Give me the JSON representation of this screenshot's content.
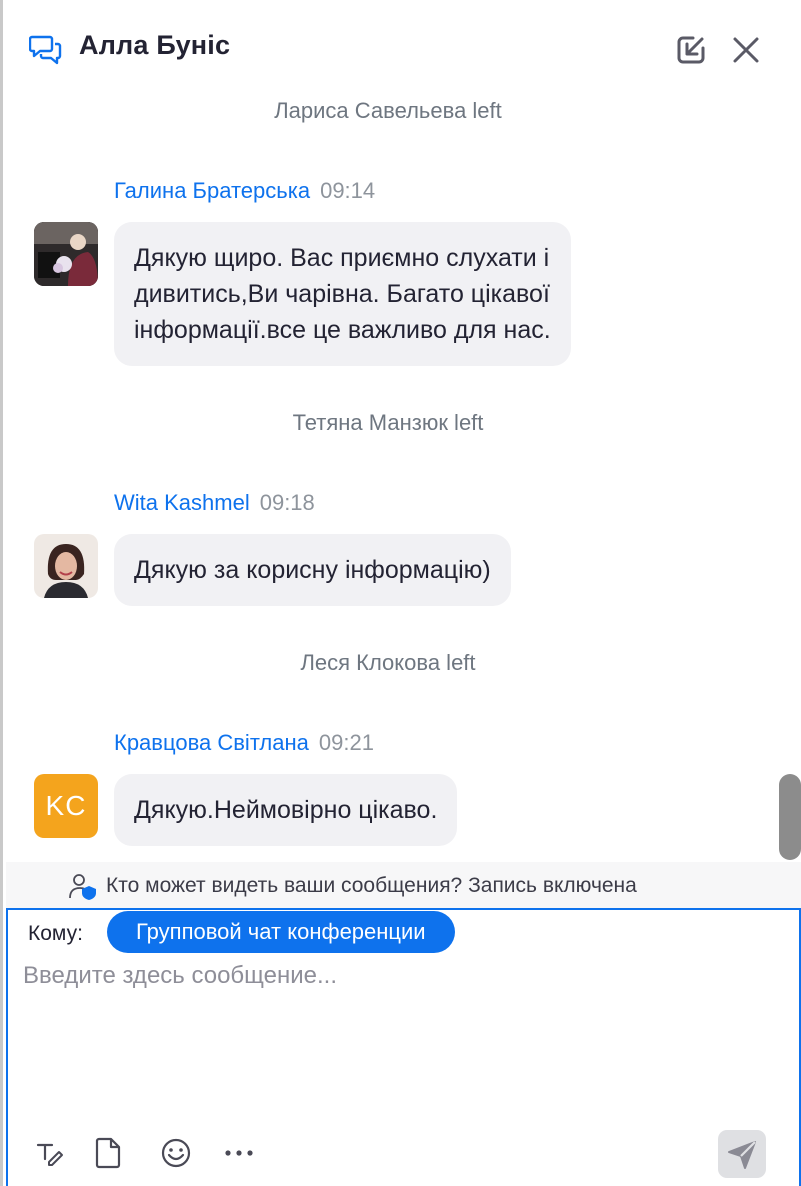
{
  "header": {
    "title": "Алла Буніс",
    "icons": [
      "chat-bubbles-icon",
      "pop-in-icon",
      "close-icon"
    ]
  },
  "messages": [
    {
      "type": "system",
      "text": "Лариса Савельева left"
    },
    {
      "type": "message",
      "sender": "Галина Братерська",
      "time": "09:14",
      "lines": [
        "Дякую щиро. Вас приємно слухати і",
        "дивитись,Ви чарівна. Багато цікавої",
        "інформації.все це важливо для нас."
      ],
      "avatar": "photo"
    },
    {
      "type": "system",
      "text": "Тетяна Манзюк left"
    },
    {
      "type": "message",
      "sender": "Wita Kashmel",
      "time": "09:18",
      "lines": [
        "Дякую за корисну інформацію)"
      ],
      "avatar": "photo"
    },
    {
      "type": "system",
      "text": "Леся Клокова left"
    },
    {
      "type": "message",
      "sender": "Кравцова Світлана",
      "time": "09:21",
      "lines": [
        "Дякую.Неймовірно цікаво."
      ],
      "avatar_initials": "KC",
      "avatar_color": "#f4a41d"
    }
  ],
  "privacy": {
    "text": "Кто может видеть ваши сообщения? Запись включена"
  },
  "composer": {
    "to_label": "Кому:",
    "recipient": "Групповой чат конференции",
    "placeholder": "Введите здесь сообщение...",
    "tools": [
      "format-text-icon",
      "file-icon",
      "emoji-icon",
      "more-icon",
      "send-icon"
    ]
  },
  "colors": {
    "accent": "#0e72ed",
    "bubble": "#f1f1f4",
    "avatar_kc": "#f4a41d"
  }
}
